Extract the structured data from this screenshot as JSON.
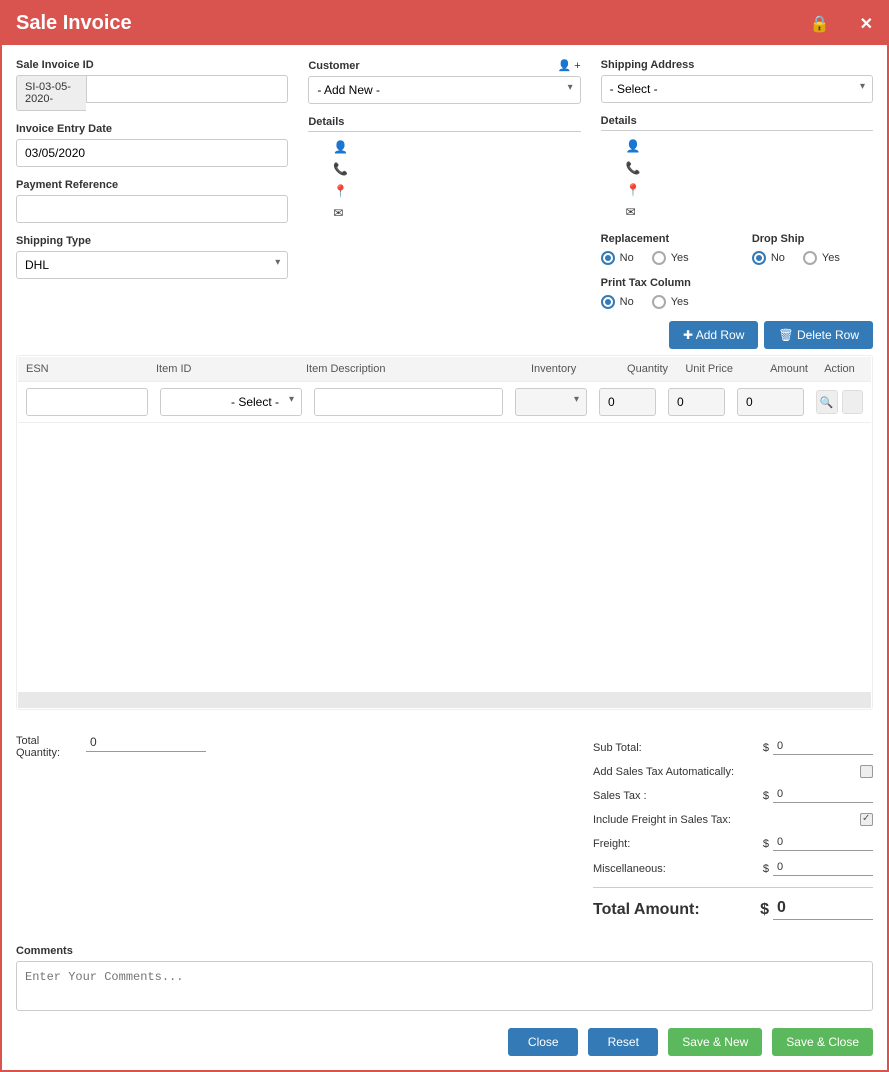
{
  "modal": {
    "title": "Sale Invoice"
  },
  "fields": {
    "sale_invoice_id_label": "Sale Invoice ID",
    "sale_invoice_id_prefix": "SI-03-05-2020-",
    "sale_invoice_id_value": "",
    "invoice_entry_date_label": "Invoice Entry Date",
    "invoice_entry_date_value": "03/05/2020",
    "payment_reference_label": "Payment Reference",
    "payment_reference_value": "",
    "shipping_type_label": "Shipping Type",
    "shipping_type_value": "DHL",
    "customer_label": "Customer",
    "customer_value": "- Add New -",
    "shipping_address_label": "Shipping Address",
    "shipping_address_value": "- Select -",
    "details_label": "Details",
    "replacement_label": "Replacement",
    "drop_ship_label": "Drop Ship",
    "print_tax_label": "Print Tax Column",
    "no_label": "No",
    "yes_label": "Yes"
  },
  "buttons": {
    "add_row": "Add Row",
    "delete_row": "Delete Row",
    "close": "Close",
    "reset": "Reset",
    "save_new": "Save & New",
    "save_close": "Save & Close"
  },
  "table": {
    "headers": {
      "esn": "ESN",
      "item_id": "Item ID",
      "item_desc": "Item Description",
      "inventory": "Inventory",
      "quantity": "Quantity",
      "unit_price": "Unit Price",
      "amount": "Amount",
      "action": "Action"
    },
    "row": {
      "esn": "",
      "item_id": "- Select -",
      "item_desc": "",
      "inventory": "",
      "quantity": "0",
      "unit_price": "0",
      "amount": "0"
    }
  },
  "totals": {
    "total_quantity_label": "Total Quantity:",
    "total_quantity_value": "0",
    "sub_total_label": "Sub Total:",
    "sub_total_value": "0",
    "add_sales_tax_label": "Add Sales Tax Automatically:",
    "sales_tax_label": "Sales Tax :",
    "sales_tax_value": "0",
    "include_freight_label": "Include Freight in Sales Tax:",
    "freight_label": "Freight:",
    "freight_value": "0",
    "misc_label": "Miscellaneous:",
    "misc_value": "0",
    "total_amount_label": "Total Amount:",
    "total_amount_value": "0",
    "currency": "$"
  },
  "comments": {
    "label": "Comments",
    "placeholder": "Enter Your Comments..."
  }
}
